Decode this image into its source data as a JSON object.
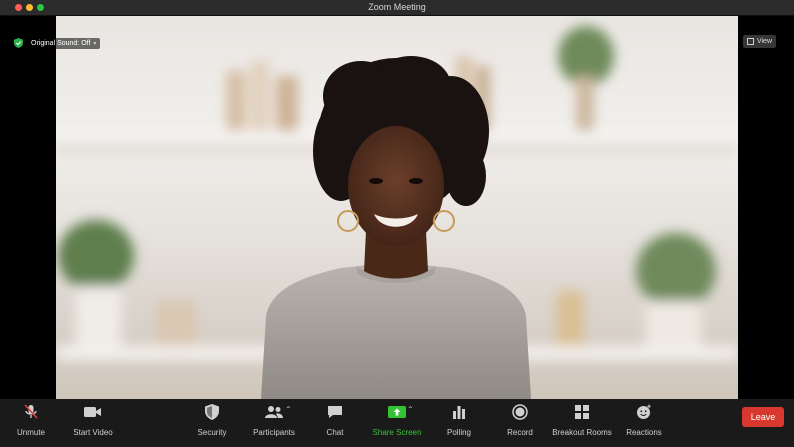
{
  "window": {
    "title": "Zoom Meeting"
  },
  "overlay": {
    "sound_label": "Original Sound: Off",
    "view_label": "View"
  },
  "toolbar": {
    "items": [
      {
        "label": "Unmute",
        "icon": "mic-muted-icon"
      },
      {
        "label": "Start Video",
        "icon": "video-camera-icon"
      },
      {
        "label": "Security",
        "icon": "shield-icon"
      },
      {
        "label": "Participants",
        "icon": "participants-icon"
      },
      {
        "label": "Chat",
        "icon": "chat-icon"
      },
      {
        "label": "Share Screen",
        "icon": "share-screen-icon"
      },
      {
        "label": "Polling",
        "icon": "polling-icon"
      },
      {
        "label": "Record",
        "icon": "record-icon"
      },
      {
        "label": "Breakout Rooms",
        "icon": "breakout-rooms-icon"
      },
      {
        "label": "Reactions",
        "icon": "reactions-icon"
      }
    ],
    "leave_label": "Leave"
  },
  "colors": {
    "leave": "#d9382f",
    "share": "#35c335",
    "toolbar_bg": "#1a1a1a"
  }
}
